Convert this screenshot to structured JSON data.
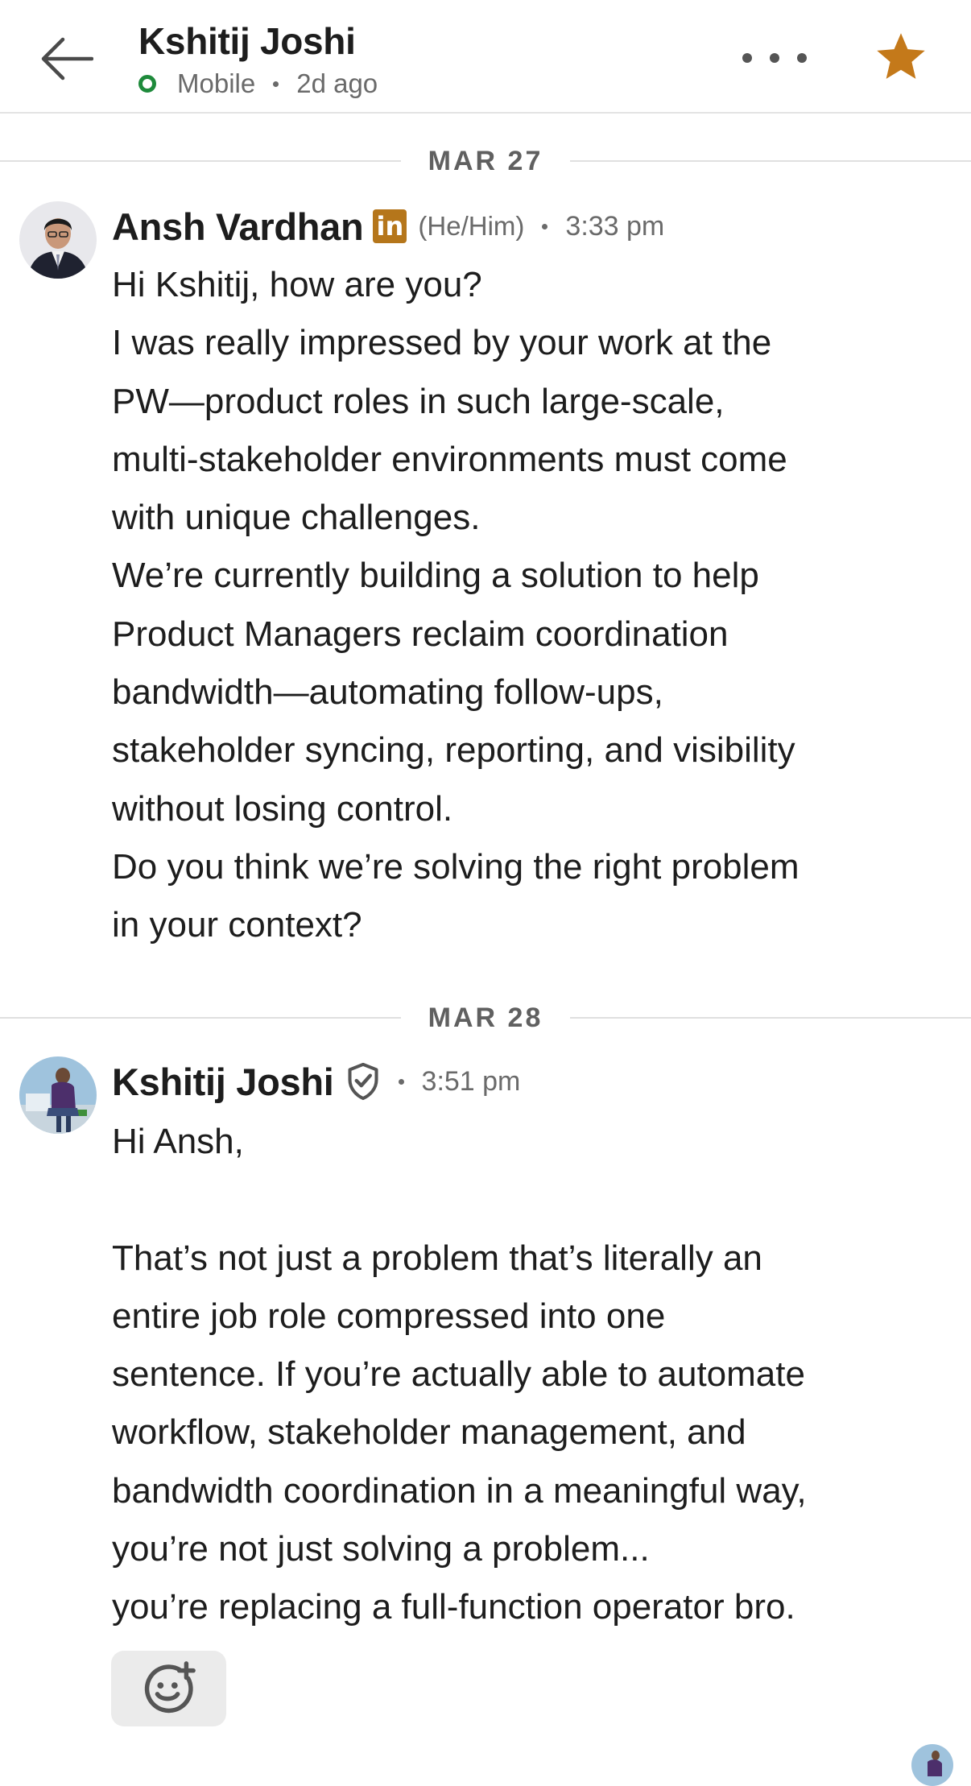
{
  "header": {
    "contact_name": "Kshitij Joshi",
    "presence": "Mobile",
    "last_active": "2d ago"
  },
  "colors": {
    "online_green": "#1e8a3b",
    "star_gold": "#c4791a",
    "linkedin_badge": "#b5761b",
    "muted_text": "#6a6a6a"
  },
  "conversation": {
    "day1": {
      "date_label": "MAR 27",
      "message": {
        "sender": "Ansh Vardhan",
        "badge_text": "in",
        "pronouns": "(He/Him)",
        "time": "3:33 pm",
        "lines": [
          "Hi Kshitij, how are you?",
          "I was really impressed by your work at the",
          "PW—product roles in such large-scale,",
          "multi-stakeholder environments must come",
          "with unique challenges.",
          "We’re currently building a solution to help",
          "Product Managers reclaim coordination",
          "bandwidth—automating follow-ups,",
          "stakeholder syncing, reporting, and visibility",
          "without losing control.",
          "Do you think we’re solving the right problem",
          "in your context?"
        ]
      }
    },
    "day2": {
      "date_label": "MAR 28",
      "message": {
        "sender": "Kshitij Joshi",
        "time": "3:51 pm",
        "lines": [
          "Hi Ansh,",
          "",
          "That’s not just a problem that’s literally an",
          "entire job role compressed into one",
          "sentence. If you’re actually able to automate",
          "workflow, stakeholder management, and",
          "bandwidth coordination in a meaningful way,",
          "you’re not just solving a problem...",
          "you’re replacing a full-function operator bro."
        ]
      }
    }
  },
  "icons": {
    "back": "arrow-left-icon",
    "more": "more-horizontal-icon",
    "star": "star-icon",
    "verified": "verified-shield-icon",
    "react": "add-reaction-icon"
  }
}
